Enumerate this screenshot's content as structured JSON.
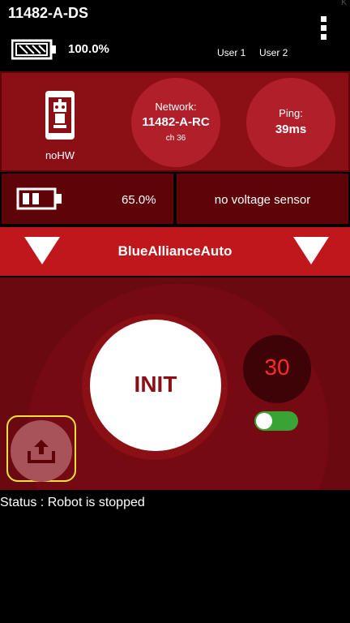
{
  "header": {
    "title": "11482-A-DS",
    "corner_mark": "K",
    "ds_battery": "100.0%",
    "users": [
      "User 1",
      "User 2"
    ]
  },
  "robot": {
    "label": "noHW",
    "network_label": "Network:",
    "network_name": "11482-A-RC",
    "network_channel": "ch 36",
    "ping_label": "Ping:",
    "ping_value": "39ms",
    "battery": "65.0%",
    "voltage_sensor": "no voltage sensor"
  },
  "opmode": {
    "name": "BlueAllianceAuto"
  },
  "controls": {
    "init_label": "INIT",
    "timer_value": "30",
    "timer_enabled": true
  },
  "status": {
    "text": "Status : Robot is stopped"
  },
  "colors": {
    "panel_red": "#8a1016",
    "bar_red": "#c0171c",
    "toggle_green": "#3aa335",
    "timer_red": "#ff2a2a",
    "highlight_yellow": "#f5e03a"
  },
  "icons": {
    "battery": "battery-full-icon",
    "phone": "robot-phone-icon",
    "robot_battery": "battery-low-icon",
    "upload": "upload-icon",
    "menu": "overflow-menu-icon"
  }
}
